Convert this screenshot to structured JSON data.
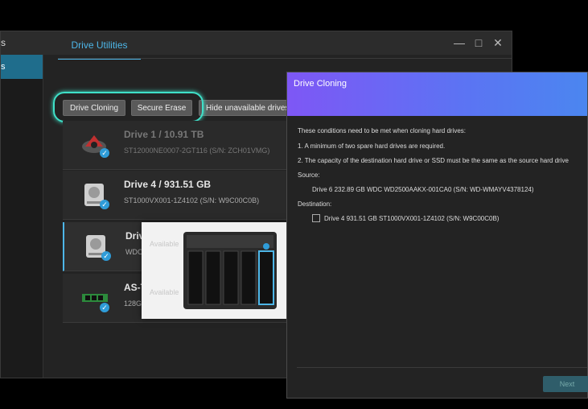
{
  "window": {
    "title": "s",
    "sidebar_active": "s",
    "minimize": "—",
    "maximize": "□",
    "close": "✕"
  },
  "tabs": [
    {
      "label": "Drive Utilities"
    }
  ],
  "toolbar": {
    "drive_cloning": "Drive Cloning",
    "secure_erase": "Secure Erase",
    "hide_unavailable": "Hide unavailable drives"
  },
  "drives": [
    {
      "name": "Drive 1 / 10.91 TB",
      "detail": "ST12000NE0007-2GT116 (S/N: ZCH01VMG)",
      "icon": "hdd-red-icon"
    },
    {
      "name": "Drive 4 / 931.51 GB",
      "detail": "ST1000VX001-1Z4102 (S/N: W9C00C0B)",
      "icon": "hdd-icon"
    },
    {
      "name": "Drive",
      "detail": "WDC",
      "icon": "hdd-icon"
    },
    {
      "name": "AS-T",
      "detail": "128G",
      "icon": "ssd-icon"
    }
  ],
  "popup": {
    "available_1": "Available",
    "available_2": "Available"
  },
  "dialog": {
    "title": "Drive Cloning",
    "intro": "These conditions need to be met when cloning hard drives:",
    "cond1": "1. A minimum of two spare hard drives are required.",
    "cond2": "2. The capacity of the destination hard drive or SSD must be the same as the source hard drive",
    "source_label": "Source:",
    "source_value": "Drive 6 232.89 GB WDC WD2500AAKX-001CA0 (S/N: WD-WMAYV4378124)",
    "destination_label": "Destination:",
    "destination_value": "Drive 4 931.51 GB ST1000VX001-1Z4102 (S/N: W9C00C0B)",
    "next": "Next"
  },
  "colors": {
    "accent": "#4db6e8",
    "highlight": "#3fe0c8",
    "header_start": "#7e57f5",
    "header_end": "#4b86f0"
  }
}
